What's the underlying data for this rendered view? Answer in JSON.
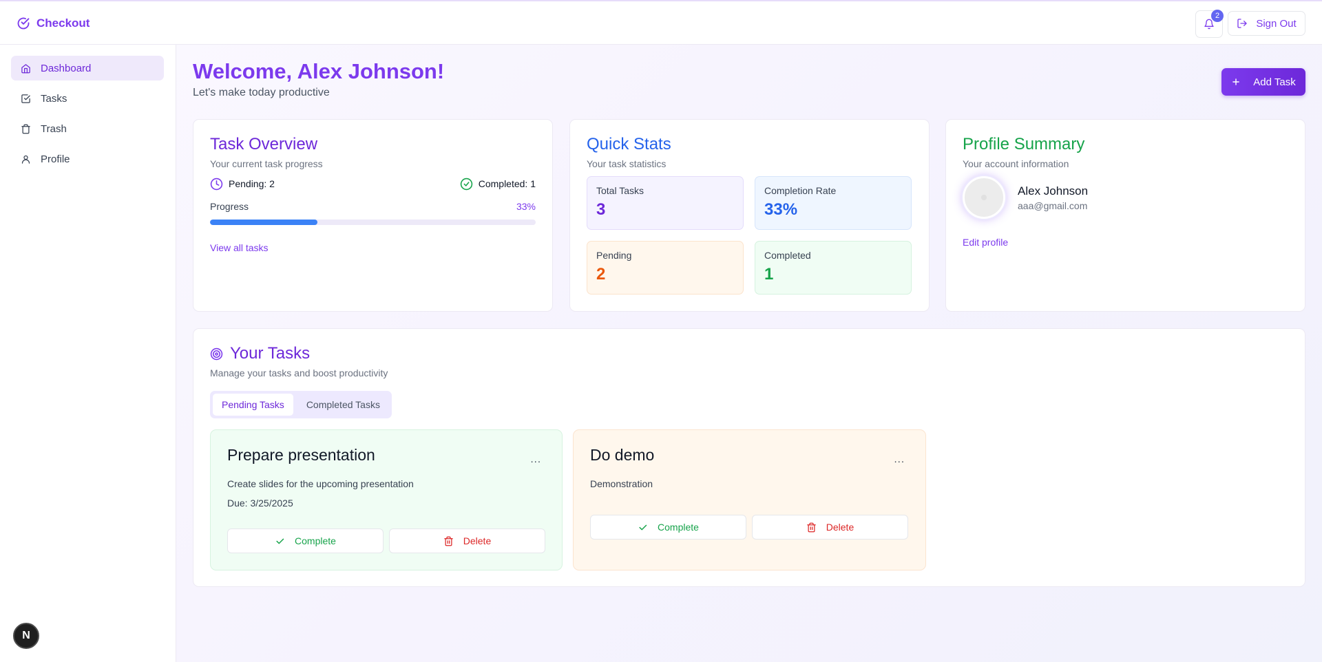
{
  "header": {
    "brand": "Checkout",
    "notifications_count": "2",
    "sign_out_label": "Sign Out"
  },
  "sidebar": {
    "items": [
      {
        "label": "Dashboard",
        "icon": "home-icon",
        "active": true
      },
      {
        "label": "Tasks",
        "icon": "check-square-icon",
        "active": false
      },
      {
        "label": "Trash",
        "icon": "trash-icon",
        "active": false
      },
      {
        "label": "Profile",
        "icon": "user-icon",
        "active": false
      }
    ],
    "badge": "N"
  },
  "main": {
    "welcome_title": "Welcome, Alex Johnson!",
    "welcome_subtitle": "Let's make today productive",
    "add_task_label": "Add Task"
  },
  "task_overview": {
    "title": "Task Overview",
    "subtitle": "Your current task progress",
    "pending_label": "Pending: 2",
    "completed_label": "Completed: 1",
    "progress_label": "Progress",
    "progress_text": "33%",
    "progress_fraction": 0.33,
    "view_all_label": "View all tasks"
  },
  "quick_stats": {
    "title": "Quick Stats",
    "subtitle": "Your task statistics",
    "stats": [
      {
        "label": "Total Tasks",
        "value": "3"
      },
      {
        "label": "Completion Rate",
        "value": "33%"
      },
      {
        "label": "Pending",
        "value": "2"
      },
      {
        "label": "Completed",
        "value": "1"
      }
    ]
  },
  "profile_summary": {
    "title": "Profile Summary",
    "subtitle": "Your account information",
    "name": "Alex Johnson",
    "email": "aaa@gmail.com",
    "edit_label": "Edit profile"
  },
  "your_tasks": {
    "title": "Your Tasks",
    "subtitle": "Manage your tasks and boost productivity",
    "tabs": [
      {
        "label": "Pending Tasks",
        "active": true
      },
      {
        "label": "Completed Tasks",
        "active": false
      }
    ],
    "items": [
      {
        "title": "Prepare presentation",
        "description": "Create slides for the upcoming presentation",
        "due": "Due: 3/25/2025",
        "complete_label": "Complete",
        "delete_label": "Delete"
      },
      {
        "title": "Do demo",
        "description": "Demonstration",
        "complete_label": "Complete",
        "delete_label": "Delete"
      }
    ],
    "menu_glyph": "..."
  },
  "colors": {
    "accent": "#7c3aed",
    "blue": "#2563eb",
    "green": "#16a34a",
    "orange": "#ea580c",
    "danger": "#dc2626"
  }
}
